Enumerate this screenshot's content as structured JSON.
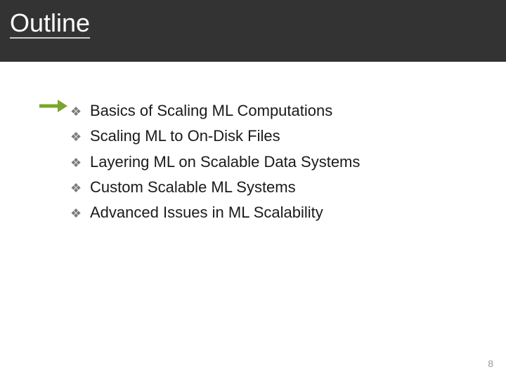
{
  "header": {
    "title": "Outline"
  },
  "colors": {
    "accent": "#7aa62b"
  },
  "bullets": [
    {
      "text": "Basics of Scaling ML Computations",
      "current": true
    },
    {
      "text": "Scaling ML to On-Disk Files",
      "current": false
    },
    {
      "text": "Layering ML on Scalable Data Systems",
      "current": false
    },
    {
      "text": "Custom Scalable ML Systems",
      "current": false
    },
    {
      "text": "Advanced Issues in ML Scalability",
      "current": false
    }
  ],
  "page_number": "8"
}
